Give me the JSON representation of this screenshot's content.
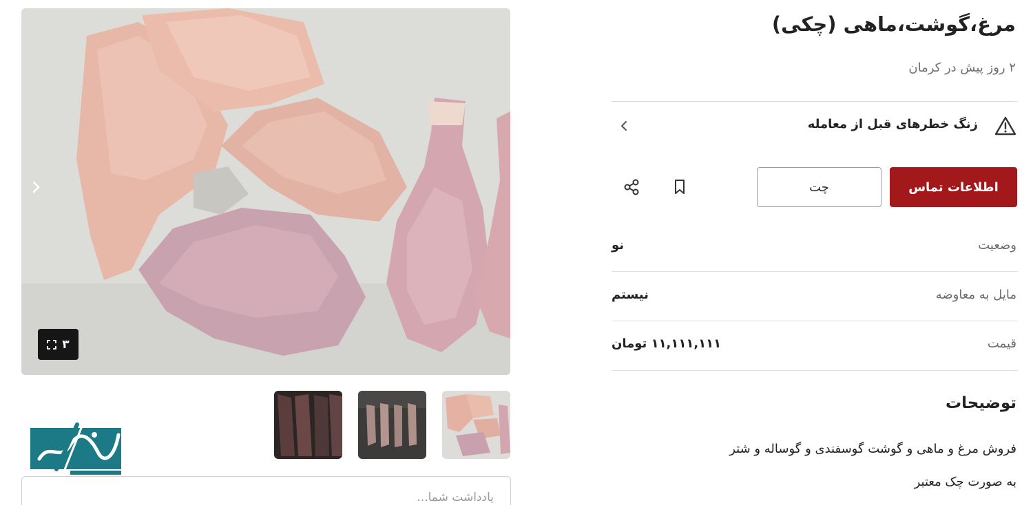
{
  "listing": {
    "title": "مرغ،گوشت،ماهی (چکی)",
    "subtitle": "۲ روز پیش در کرمان",
    "warning": "زنگ خطرهای قبل از معامله"
  },
  "gallery": {
    "photo_count": "۳",
    "thumbnail_count": 3
  },
  "actions": {
    "contact_label": "اطلاعات تماس",
    "chat_label": "چت",
    "accent_color": "#a3191b"
  },
  "attributes": [
    {
      "label": "وضعیت",
      "value": "نو"
    },
    {
      "label": "مایل به معاوضه",
      "value": "نیستم"
    },
    {
      "label": "قیمت",
      "value": "۱۱,۱۱۱,۱۱۱ تومان"
    }
  ],
  "description": {
    "heading": "توضیحات",
    "lines": [
      "فروش مرغ و ماهی و گوشت گوسفندی و گوساله و شتر",
      "به صورت چک معتبر"
    ]
  },
  "note": {
    "placeholder": "یادداشت شما..."
  },
  "icons": {
    "warning": "warning-triangle-icon",
    "chevron": "chevron-left-icon",
    "bookmark": "bookmark-icon",
    "share": "share-icon",
    "expand": "expand-icon",
    "next": "chevron-right-icon"
  }
}
